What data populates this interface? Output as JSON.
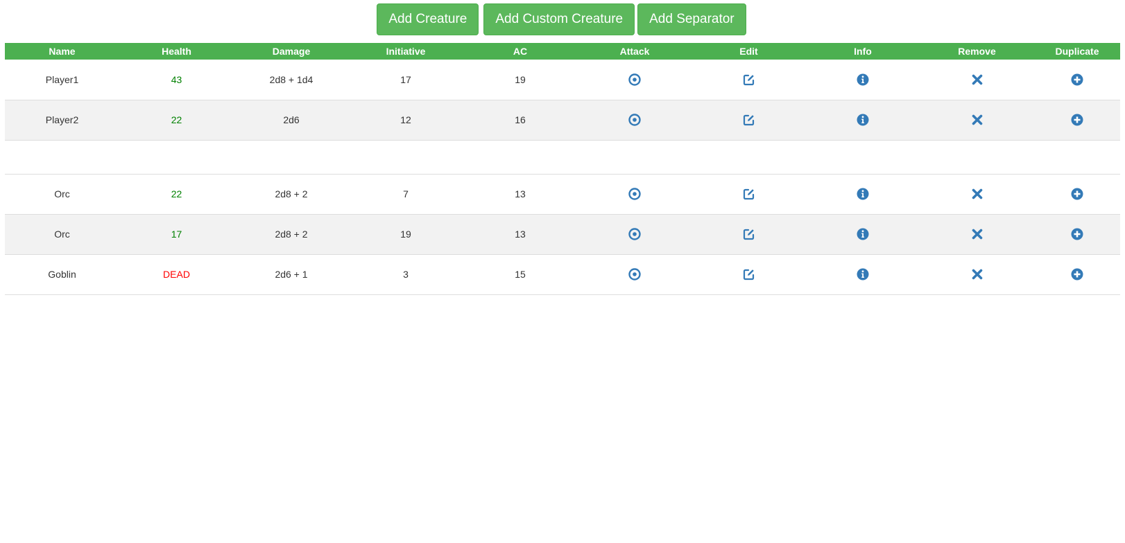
{
  "toolbar": {
    "add_creature_label": "Add Creature",
    "add_custom_creature_label": "Add Custom Creature",
    "add_separator_label": "Add Separator"
  },
  "table": {
    "headers": [
      "Name",
      "Health",
      "Damage",
      "Initiative",
      "AC",
      "Attack",
      "Edit",
      "Info",
      "Remove",
      "Duplicate"
    ],
    "rows": [
      {
        "type": "creature",
        "name": "Player1",
        "health": "43",
        "health_status": "alive",
        "damage": "2d8 + 1d4",
        "initiative": "17",
        "ac": "19"
      },
      {
        "type": "creature",
        "name": "Player2",
        "health": "22",
        "health_status": "alive",
        "damage": "2d6",
        "initiative": "12",
        "ac": "16"
      },
      {
        "type": "separator"
      },
      {
        "type": "creature",
        "name": "Orc",
        "health": "22",
        "health_status": "alive",
        "damage": "2d8 + 2",
        "initiative": "7",
        "ac": "13"
      },
      {
        "type": "creature",
        "name": "Orc",
        "health": "17",
        "health_status": "alive",
        "damage": "2d8 + 2",
        "initiative": "19",
        "ac": "13"
      },
      {
        "type": "creature",
        "name": "Goblin",
        "health": "DEAD",
        "health_status": "dead",
        "damage": "2d6 + 1",
        "initiative": "3",
        "ac": "15"
      }
    ],
    "action_icons": [
      "target-icon",
      "edit-icon",
      "info-icon",
      "remove-icon",
      "duplicate-icon"
    ]
  },
  "colors": {
    "accent_green": "#4cb050",
    "button_green": "#5cb85c",
    "icon_blue": "#337ab7",
    "health_alive": "#008000",
    "health_dead": "#ff0000"
  }
}
